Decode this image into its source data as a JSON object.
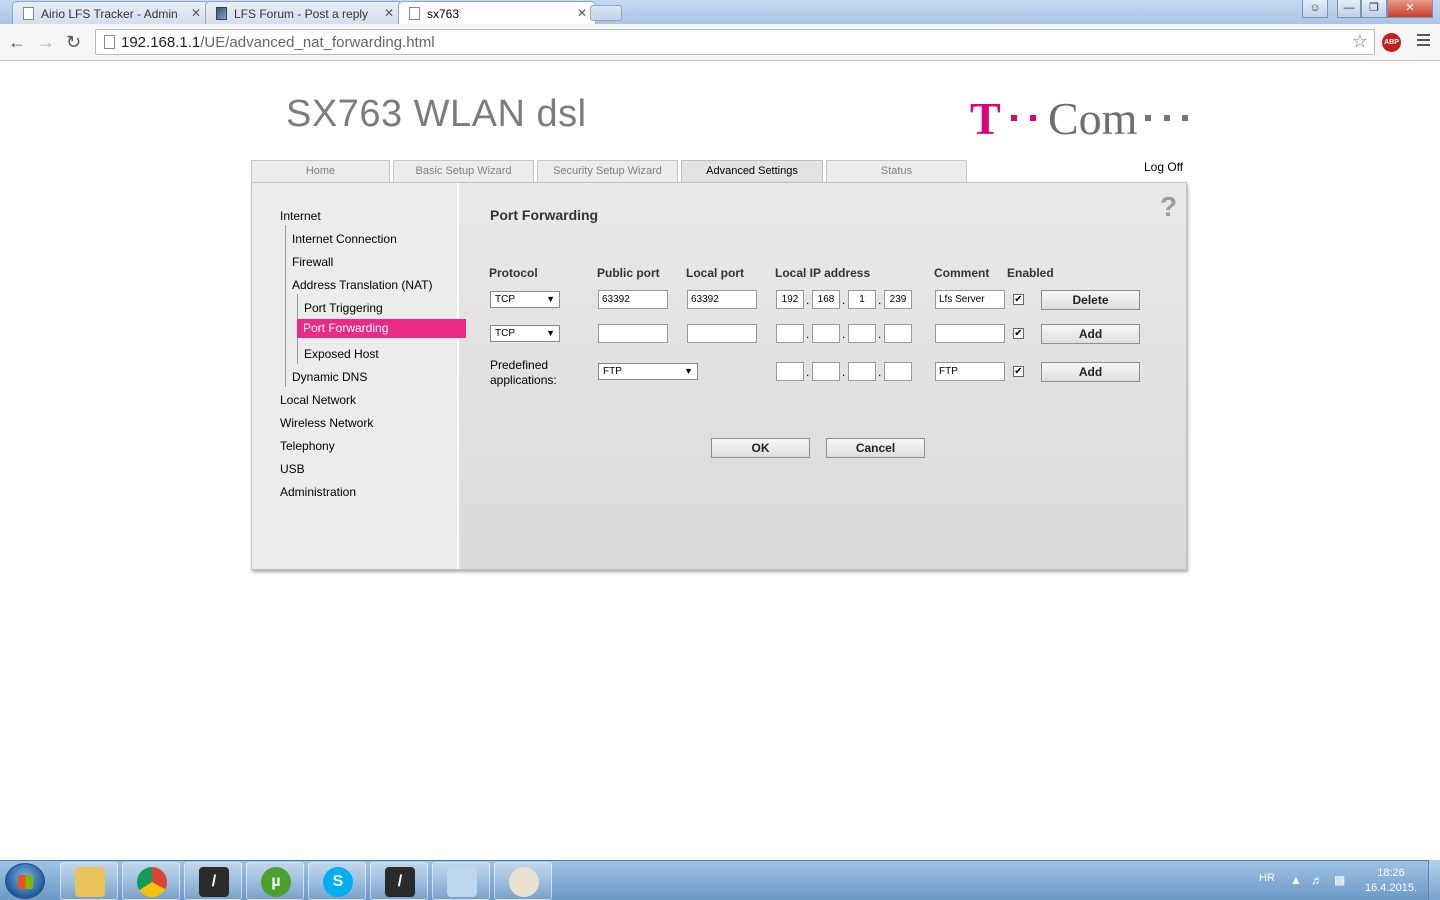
{
  "browser": {
    "tabs": [
      {
        "title": "Airio LFS Tracker - Admin",
        "icon": "page-icon"
      },
      {
        "title": "LFS Forum - Post a reply",
        "icon": "lfs-icon"
      },
      {
        "title": "sx763",
        "icon": "page-icon"
      }
    ],
    "url_host": "192.168.1.1",
    "url_path": "/UE/advanced_nat_forwarding.html",
    "abp_label": "ABP"
  },
  "router": {
    "product_name": "SX763 WLAN dsl",
    "brand_letter": "T",
    "brand_word": "Com",
    "brand_color": "#e2007a",
    "nav_tabs": [
      "Home",
      "Basic Setup Wizard",
      "Security Setup Wizard",
      "Advanced Settings",
      "Status"
    ],
    "active_tab": "Advanced Settings",
    "logoff": "Log Off",
    "sidebar": {
      "internet": "Internet",
      "internet_connection": "Internet Connection",
      "firewall": "Firewall",
      "nat": "Address Translation (NAT)",
      "port_triggering": "Port Triggering",
      "port_forwarding": "Port Forwarding",
      "exposed_host": "Exposed Host",
      "dynamic_dns": "Dynamic DNS",
      "local_network": "Local Network",
      "wireless_network": "Wireless Network",
      "telephony": "Telephony",
      "usb": "USB",
      "administration": "Administration"
    },
    "content": {
      "title": "Port Forwarding",
      "help": "?",
      "headers": {
        "protocol": "Protocol",
        "public_port": "Public port",
        "local_port": "Local port",
        "local_ip": "Local IP address",
        "comment": "Comment",
        "enabled": "Enabled"
      },
      "rows": [
        {
          "protocol": "TCP",
          "public_port": "63392",
          "local_port": "63392",
          "ip": [
            "192",
            "168",
            "1",
            "239"
          ],
          "comment": "Lfs Server",
          "enabled": true,
          "action": "Delete"
        },
        {
          "protocol": "TCP",
          "public_port": "",
          "local_port": "",
          "ip": [
            "",
            "",
            "",
            ""
          ],
          "comment": "",
          "enabled": true,
          "action": "Add"
        }
      ],
      "predefined": {
        "label_line1": "Predefined",
        "label_line2": "applications:",
        "app": "FTP",
        "ip": [
          "",
          "",
          "",
          ""
        ],
        "comment": "FTP",
        "enabled": true,
        "action": "Add"
      },
      "ok": "OK",
      "cancel": "Cancel"
    }
  },
  "taskbar": {
    "apps": [
      "explorer",
      "chrome",
      "lfs",
      "utorrent",
      "skype",
      "lfs",
      "notepad",
      "paint"
    ],
    "lang": "HR",
    "time": "18:26",
    "date": "16.4.2015."
  }
}
